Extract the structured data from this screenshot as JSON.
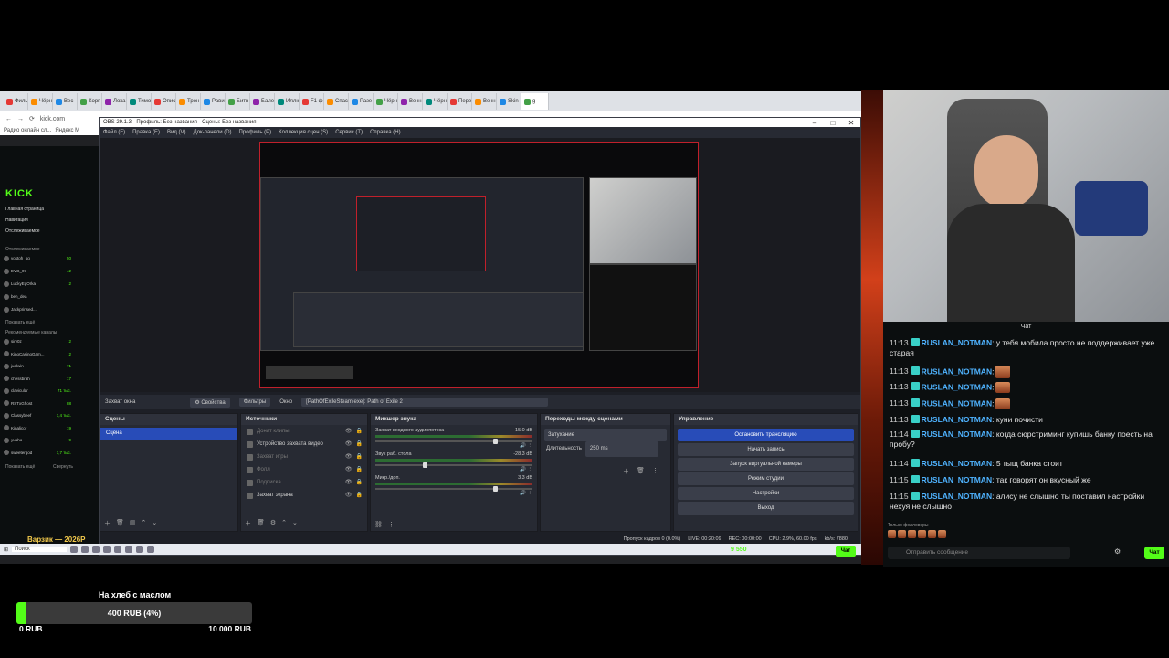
{
  "browser": {
    "tabs": [
      "Фильмы",
      "Чёрн",
      "Вес",
      "Корп",
      "Лоха",
      "Тимо",
      "Опис",
      "Трон",
      "Рави",
      "Битв",
      "Бале",
      "Иллю",
      "F1 ф",
      "Спас",
      "Разе",
      "Чёрн",
      "Вечн",
      "Чёрн",
      "Пере",
      "Вечн",
      "Skin",
      "g"
    ],
    "url": "kick.com",
    "bookmark": "Радио онлайн сл...",
    "bookmark2": "Яндекс М"
  },
  "kick": {
    "logo": "KICK",
    "nav": [
      "Главная страница",
      "Навигация",
      "Отслеживаемое"
    ],
    "following_header": "Отслеживаемое",
    "users": [
      {
        "name": "vostoh_og",
        "count": "50"
      },
      {
        "name": "EVG_07",
        "count": "42"
      },
      {
        "name": "LuckyEgOrka",
        "count": "2"
      },
      {
        "name": "ben_dea",
        "count": ""
      },
      {
        "name": "Jackprinsed...",
        "count": ""
      }
    ],
    "show_more": "Показать ещё",
    "recommended_header": "Рекомендуемые каналы",
    "recommended": [
      {
        "name": "sirv0z",
        "count": "2"
      },
      {
        "name": "KinoCasinoGam...",
        "count": "2"
      },
      {
        "name": "juelwin",
        "count": "71"
      },
      {
        "name": "chessbrah",
        "count": "17"
      },
      {
        "name": "clavicular",
        "count": "71 тыс."
      },
      {
        "name": "RSTxGhost",
        "count": "88"
      },
      {
        "name": "Classybeef",
        "count": "1,4 тыс."
      },
      {
        "name": "Kinalicor",
        "count": "19"
      },
      {
        "name": "yuaho",
        "count": "9"
      },
      {
        "name": "sweetergod",
        "count": "1,7 тыс."
      }
    ],
    "show_more2": "Показать ещё",
    "collapse": "Свернуть"
  },
  "obs": {
    "title": "OBS 29.1.3 - Профиль: Без названия - Сцены: Без названия",
    "menu": [
      "Файл (F)",
      "Правка (E)",
      "Вид (V)",
      "Док-панели (D)",
      "Профиль (P)",
      "Коллекция сцен (S)",
      "Сервис (T)",
      "Справка (H)"
    ],
    "sourcebar": {
      "source_name": "Захват окна",
      "properties": "Свойства",
      "filters": "Фильтры",
      "window_label": "Окно",
      "window_value": "[PathOfExileSteam.exe]: Path of Exile 2"
    },
    "scenes": {
      "title": "Сцены",
      "items": [
        "Сцена"
      ]
    },
    "sources": {
      "title": "Источники",
      "items": [
        "Донат клипы",
        "Устройство захвата видео",
        "Захват игры",
        "Фолл",
        "Подписка",
        "Захват экрана"
      ]
    },
    "mixer": {
      "title": "Микшер звука",
      "channels": [
        {
          "name": "Захват входного аудиопотока",
          "db": "15.0 dB"
        },
        {
          "name": "Звук раб. стола",
          "db": "-28.3 dB"
        },
        {
          "name": "Микр./доп.",
          "db": "3.3 dB"
        }
      ]
    },
    "transitions": {
      "title": "Переходы между сценами",
      "type": "Затухание",
      "duration_label": "Длительность",
      "duration": "250 ms"
    },
    "controls": {
      "title": "Управление",
      "buttons": [
        "Остановить трансляцию",
        "Начать запись",
        "Запуск виртуальной камеры",
        "Режим студии",
        "Настройки",
        "Выход"
      ]
    },
    "status": {
      "dropped": "Пропуск кадров 0 (0.0%)",
      "live": "LIVE: 00:20:09",
      "rec": "REC: 00:00:00",
      "cpu": "CPU: 2.9%, 60.00 fps",
      "kbps": "kb/s: 7880"
    },
    "preview_overlay": "На хлеб с маслом"
  },
  "taskbar": {
    "search": "Поиск",
    "viewers": "9 550",
    "chat_btn": "Чат"
  },
  "chat": {
    "title": "Чат",
    "messages": [
      {
        "time": "11:13",
        "user": "RUSLAN_NOTMAN",
        "text": ": у тебя мобила просто не поддерживает уже старая"
      },
      {
        "time": "11:13",
        "user": "RUSLAN_NOTMAN",
        "text": ":"
      },
      {
        "time": "11:13",
        "user": "RUSLAN_NOTMAN",
        "text": ":"
      },
      {
        "time": "11:13",
        "user": "RUSLAN_NOTMAN",
        "text": ":"
      },
      {
        "time": "11:13",
        "user": "RUSLAN_NOTMAN",
        "text": ": куни почисти"
      },
      {
        "time": "11:14",
        "user": "RUSLAN_NOTMAN",
        "text": ": когда сюрстриминг купишь банку поесть на пробу?"
      },
      {
        "time": "11:14",
        "user": "RUSLAN_NOTMAN",
        "text": ": 5 тыщ банка стоит"
      },
      {
        "time": "11:15",
        "user": "RUSLAN_NOTMAN",
        "text": ": так говорят он вкусный же"
      },
      {
        "time": "11:15",
        "user": "RUSLAN_NOTMAN",
        "text": ": алису не слышно ты поставил настройки нехуя не слышно"
      }
    ],
    "followers_only": "Только фолловеры",
    "input_placeholder": "Отправить сообщение",
    "send": "Чат"
  },
  "goal": {
    "title": "На хлеб с маслом",
    "value_text": "400 RUB (4%)",
    "fraction": 0.04,
    "min": "0 RUB",
    "max": "10 000 RUB"
  },
  "overlay": {
    "alert": "Варзик — 2026Р"
  },
  "colors": {
    "kick_green": "#53fc18",
    "obs_blue": "#284cb8",
    "chat_name": "#4fb3ff"
  }
}
